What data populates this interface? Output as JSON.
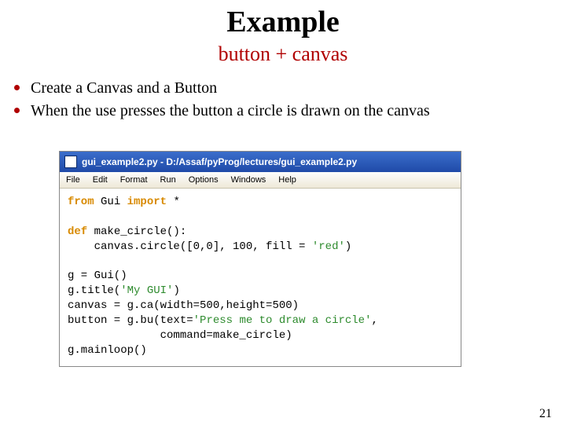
{
  "title": "Example",
  "subtitle": "button + canvas",
  "bullets": [
    "Create a Canvas and a Button",
    "When the use presses the button a circle is drawn on the canvas"
  ],
  "window": {
    "title": "gui_example2.py - D:/Assaf/pyProg/lectures/gui_example2.py",
    "menus": [
      "File",
      "Edit",
      "Format",
      "Run",
      "Options",
      "Windows",
      "Help"
    ]
  },
  "code": {
    "l1a": "from",
    "l1b": " Gui ",
    "l1c": "import",
    "l1d": " *",
    "l2a": "def",
    "l2b": " make_circle():",
    "l3a": "    canvas.circle([0,0], 100, fill = ",
    "l3b": "'red'",
    "l3c": ")",
    "l4": "g = Gui()",
    "l5a": "g.title(",
    "l5b": "'My GUI'",
    "l5c": ")",
    "l6": "canvas = g.ca(width=500,height=500)",
    "l7a": "button = g.bu(text=",
    "l7b": "'Press me to draw a circle'",
    "l7c": ",",
    "l8": "              command=make_circle)",
    "l9": "g.mainloop()"
  },
  "page_number": "21"
}
